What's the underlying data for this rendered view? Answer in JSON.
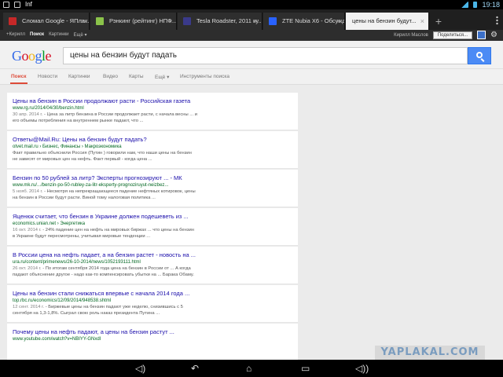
{
  "status_bar": {
    "left_icons": [
      "screenshot-icon",
      "usb-icon",
      "image-icon"
    ],
    "left_label": "Inf",
    "time": "19:18"
  },
  "tabs": [
    {
      "title": "Сломал Google - ЯПлак...",
      "fav_color": "#c62828"
    },
    {
      "title": "Рэнкинг (рейтинг) НПФ...",
      "fav_color": "#8bc34a"
    },
    {
      "title": "Tesla Roadster, 2011 ку...",
      "fav_color": "#3a3a8a"
    },
    {
      "title": "ZTE Nubia X6 - Обсужд...",
      "fav_color": "#2962ff"
    },
    {
      "title": "цены на бензин будут...",
      "fav_color": "#ffffff"
    }
  ],
  "gbar": {
    "items": [
      "+Кирилл",
      "Поиск",
      "Картинки",
      "Ещё ▾"
    ],
    "user": "Кирилл Маслов",
    "share": "Поделиться..."
  },
  "search": {
    "query": "цены на бензин будут падать"
  },
  "nav_tabs": [
    "Поиск",
    "Новости",
    "Картинки",
    "Видео",
    "Карты",
    "Ещё ▾",
    "Инструменты поиска"
  ],
  "results": [
    {
      "title": "Цены на бензин в России продолжают расти - Российская газета",
      "url": "www.rg.ru/2014/04/30/benzin.html",
      "date": "30 апр. 2014 г.",
      "snippet1": " - Цена за литр бензина в России продолжает расти, с начала весны ... и",
      "snippet2": "его объемы потребления на внутреннем рынке падают, что ..."
    },
    {
      "title": "Ответы@Mail.Ru: Цены на бензин будут падать?",
      "url": "otvet.mail.ru › Бизнес, Финансы › Макроэкономика",
      "date": "",
      "snippet1": "Факт правильно объяснили Россия (Путин ) говорили нам, что наши цены на бензин",
      "snippet2": "не зависят от мировых цен на нефть. Факт первый - когда цена ..."
    },
    {
      "title": "Бензин по 50 рублей за литр? Эксперты прогнозируют ... - МК",
      "url": "www.mk.ru/.../benzin-po-50-rubley-za-litr-eksperty-prognoziruyut-neizbez...",
      "date": "5 нояб. 2014 г.",
      "snippet1": " - Несмотря на непрекращающееся падение нефтяных котировок, цены",
      "snippet2": "на бензин в России будут расти. Виной тому налоговая политика ..."
    },
    {
      "title": "Яценюк считает, что бензин в Украине должен подешеветь из ...",
      "url": "economics.unian.net › Энергетика",
      "date": "16 окт. 2014 г.",
      "snippet1": " - 24% падение цен на нефть на мировых биржах ... что цены на бензин",
      "snippet2": "в Украине будут пересмотрены, учитывая мировые тенденции ..."
    },
    {
      "title": "В России цена на нефть падает, а на бензин растет - новость на ...",
      "url": "ura.ru/content/primenews/26-10-2014/news/1052193111.html",
      "date": "26 окт. 2014 г.",
      "snippet1": " - По итогам сентября 2014 года цена на бензин в России от ... А когда",
      "snippet2": "падают объяснение другое - надо как-то компенсировать убытки на ... Барака Обаму."
    },
    {
      "title": "Цены на бензин стали снижаться впервые с начала 2014 года ...",
      "url": "top.rbc.ru/economics/12/09/2014/948538.shtml",
      "date": "12 сент. 2014 г.",
      "snippet1": " - Биржевые цены на бензин падают уже неделю, снизившись с 5",
      "snippet2": "сентября на 1,3-1,8%. Сыграл свою роль наказ президента Путина ..."
    },
    {
      "title": "Почему цены на нефть падают, а цены на бензин растут ...",
      "url": "www.youtube.com/watch?v=NBIYY-GNxdI",
      "date": "",
      "snippet1": "",
      "snippet2": ""
    }
  ],
  "watermark": "YAPLAKAL.COM"
}
